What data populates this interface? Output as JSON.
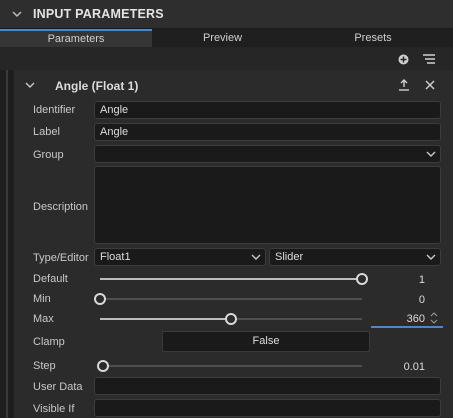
{
  "header": {
    "title": "INPUT PARAMETERS"
  },
  "tabs": [
    {
      "label": "Parameters",
      "active": true
    },
    {
      "label": "Preview",
      "active": false
    },
    {
      "label": "Presets",
      "active": false
    }
  ],
  "param": {
    "title": "Angle (Float 1)",
    "identifier": {
      "label": "Identifier",
      "value": "Angle"
    },
    "label": {
      "label": "Label",
      "value": "Angle"
    },
    "group": {
      "label": "Group",
      "value": ""
    },
    "description": {
      "label": "Description",
      "value": ""
    },
    "type_editor": {
      "label": "Type/Editor",
      "type": "Float1",
      "editor": "Slider"
    },
    "default": {
      "label": "Default",
      "value": "1",
      "level": 1.0
    },
    "min": {
      "label": "Min",
      "value": "0",
      "level": 0.0
    },
    "max": {
      "label": "Max",
      "value": "360",
      "level": 0.5
    },
    "clamp": {
      "label": "Clamp",
      "value": "False"
    },
    "step": {
      "label": "Step",
      "value": "0.01",
      "level": 0.01
    },
    "user_data": {
      "label": "User Data",
      "value": ""
    },
    "visible_if": {
      "label": "Visible If",
      "value": ""
    }
  },
  "colors": {
    "accent": "#4a89c8",
    "background": "#2b2b2b",
    "field": "#1a1a1a"
  },
  "icons": [
    "collapse-chevron-icon",
    "add-icon",
    "list-menu-icon",
    "export-icon",
    "close-icon",
    "chevron-down-icon"
  ]
}
